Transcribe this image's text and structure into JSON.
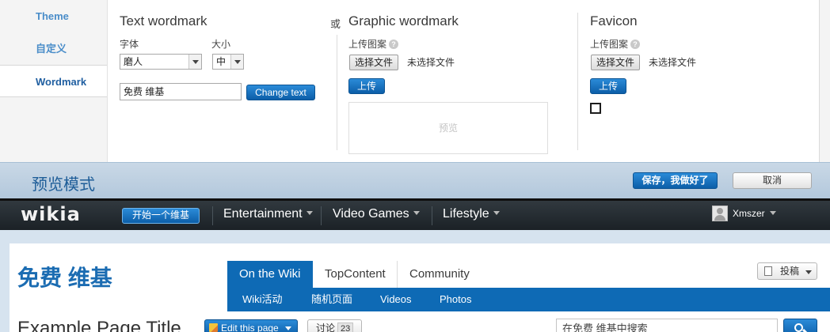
{
  "designer": {
    "tabs": [
      "Theme",
      "自定义",
      "Wordmark"
    ],
    "active_tab": "Wordmark",
    "text_wordmark": {
      "title": "Text wordmark",
      "font_label": "字体",
      "font_value": "磨人",
      "size_label": "大小",
      "size_value": "中",
      "text_value": "免费 维基",
      "change_button": "Change text"
    },
    "or_label": "或",
    "graphic_wordmark": {
      "title": "Graphic wordmark",
      "upload_label": "上传图案",
      "choose_file": "选择文件",
      "no_file": "未选择文件",
      "upload_button": "上传",
      "preview": "预览"
    },
    "favicon": {
      "title": "Favicon",
      "upload_label": "上传图案",
      "choose_file": "选择文件",
      "no_file": "未选择文件",
      "upload_button": "上传"
    }
  },
  "preview_bar": {
    "title": "预览模式",
    "save_button": "保存，我做好了",
    "cancel_button": "取消"
  },
  "global_nav": {
    "logo": "wikia",
    "start_wiki": "开始一个维基",
    "items": [
      "Entertainment",
      "Video Games",
      "Lifestyle"
    ],
    "user": "Xmszer"
  },
  "wiki": {
    "name": "免费 维基",
    "tabs": [
      "On the Wiki",
      "TopContent",
      "Community"
    ],
    "subnav": [
      "Wiki活动",
      "随机页面",
      "Videos",
      "Photos"
    ],
    "contribute": "投稿",
    "page_title": "Example Page Title",
    "edit_button": "Edit this page",
    "talk_label": "讨论",
    "talk_count": "23",
    "search_placeholder": "在免费 维基中搜索"
  },
  "colors": {
    "accent": "#0e6ab5",
    "preview_bar": "#c0d2e3",
    "global_nav": "#252c31",
    "page_bg": "#d6e3ef"
  }
}
